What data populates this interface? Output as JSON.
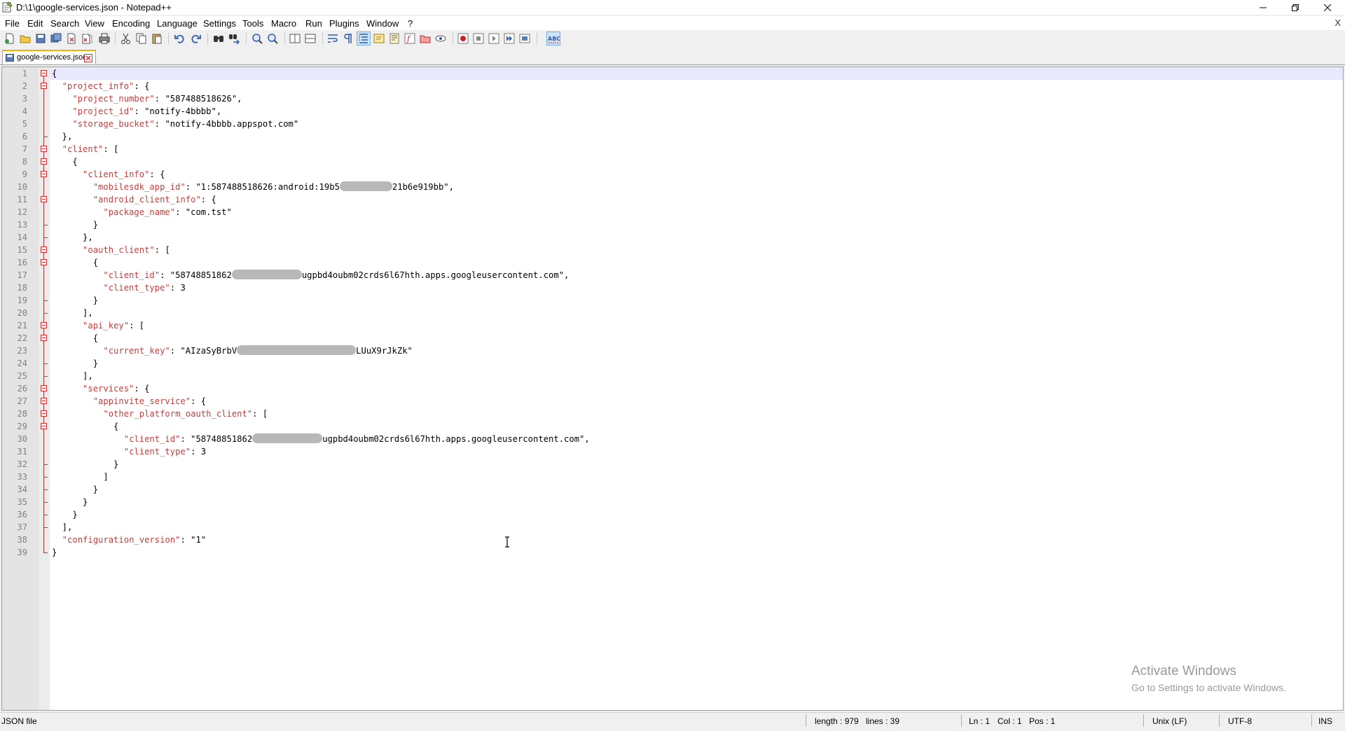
{
  "window": {
    "title": "D:\\1\\google-services.json - Notepad++"
  },
  "menu": [
    "File",
    "Edit",
    "Search",
    "View",
    "Encoding",
    "Language",
    "Settings",
    "Tools",
    "Macro",
    "Run",
    "Plugins",
    "Window",
    "?"
  ],
  "menu_close": "X",
  "tab": {
    "label": "google-services.json"
  },
  "lines": [
    {
      "n": "1",
      "segs": [
        [
          "p",
          "{"
        ]
      ]
    },
    {
      "n": "2",
      "segs": [
        [
          "p",
          "  "
        ],
        [
          "k",
          "\"project_info\""
        ],
        [
          "p",
          ": {"
        ]
      ]
    },
    {
      "n": "3",
      "segs": [
        [
          "p",
          "    "
        ],
        [
          "k",
          "\"project_number\""
        ],
        [
          "p",
          ": \"587488518626\","
        ]
      ]
    },
    {
      "n": "4",
      "segs": [
        [
          "p",
          "    "
        ],
        [
          "k",
          "\"project_id\""
        ],
        [
          "p",
          ": \"notify-4bbbb\","
        ]
      ]
    },
    {
      "n": "5",
      "segs": [
        [
          "p",
          "    "
        ],
        [
          "k",
          "\"storage_bucket\""
        ],
        [
          "p",
          ": \"notify-4bbbb.appspot.com\""
        ]
      ]
    },
    {
      "n": "6",
      "segs": [
        [
          "p",
          "  },"
        ]
      ]
    },
    {
      "n": "7",
      "segs": [
        [
          "p",
          "  "
        ],
        [
          "k",
          "\"client\""
        ],
        [
          "p",
          ": ["
        ]
      ]
    },
    {
      "n": "8",
      "segs": [
        [
          "p",
          "    {"
        ]
      ]
    },
    {
      "n": "9",
      "segs": [
        [
          "p",
          "      "
        ],
        [
          "k",
          "\"client_info\""
        ],
        [
          "p",
          ": {"
        ]
      ]
    },
    {
      "n": "10",
      "segs": [
        [
          "p",
          "        "
        ],
        [
          "k",
          "\"mobilesdk_app_id\""
        ],
        [
          "p",
          ": \"1:587488518626:android:19b5"
        ],
        [
          "b",
          "75"
        ],
        [
          "p",
          "21b6e919bb\","
        ]
      ]
    },
    {
      "n": "11",
      "segs": [
        [
          "p",
          "        "
        ],
        [
          "k",
          "\"android_client_info\""
        ],
        [
          "p",
          ": {"
        ]
      ]
    },
    {
      "n": "12",
      "segs": [
        [
          "p",
          "          "
        ],
        [
          "k",
          "\"package_name\""
        ],
        [
          "p",
          ": \"com.tst\""
        ]
      ]
    },
    {
      "n": "13",
      "segs": [
        [
          "p",
          "        }"
        ]
      ]
    },
    {
      "n": "14",
      "segs": [
        [
          "p",
          "      },"
        ]
      ]
    },
    {
      "n": "15",
      "segs": [
        [
          "p",
          "      "
        ],
        [
          "k",
          "\"oauth_client\""
        ],
        [
          "p",
          ": ["
        ]
      ]
    },
    {
      "n": "16",
      "segs": [
        [
          "p",
          "        {"
        ]
      ]
    },
    {
      "n": "17",
      "segs": [
        [
          "p",
          "          "
        ],
        [
          "k",
          "\"client_id\""
        ],
        [
          "p",
          ": \"58748851862"
        ],
        [
          "b",
          "100"
        ],
        [
          "p",
          "ugpbd4oubm02crds6l67hth.apps.googleusercontent.com\","
        ]
      ]
    },
    {
      "n": "18",
      "segs": [
        [
          "p",
          "          "
        ],
        [
          "k",
          "\"client_type\""
        ],
        [
          "p",
          ": 3"
        ]
      ]
    },
    {
      "n": "19",
      "segs": [
        [
          "p",
          "        }"
        ]
      ]
    },
    {
      "n": "20",
      "segs": [
        [
          "p",
          "      ],"
        ]
      ]
    },
    {
      "n": "21",
      "segs": [
        [
          "p",
          "      "
        ],
        [
          "k",
          "\"api_key\""
        ],
        [
          "p",
          ": ["
        ]
      ]
    },
    {
      "n": "22",
      "segs": [
        [
          "p",
          "        {"
        ]
      ]
    },
    {
      "n": "23",
      "segs": [
        [
          "p",
          "          "
        ],
        [
          "k",
          "\"current_key\""
        ],
        [
          "p",
          ": \"AIzaSyBrbV"
        ],
        [
          "b",
          "170"
        ],
        [
          "p",
          "LUuX9rJkZk\""
        ]
      ]
    },
    {
      "n": "24",
      "segs": [
        [
          "p",
          "        }"
        ]
      ]
    },
    {
      "n": "25",
      "segs": [
        [
          "p",
          "      ],"
        ]
      ]
    },
    {
      "n": "26",
      "segs": [
        [
          "p",
          "      "
        ],
        [
          "k",
          "\"services\""
        ],
        [
          "p",
          ": {"
        ]
      ]
    },
    {
      "n": "27",
      "segs": [
        [
          "p",
          "        "
        ],
        [
          "k",
          "\"appinvite_service\""
        ],
        [
          "p",
          ": {"
        ]
      ]
    },
    {
      "n": "28",
      "segs": [
        [
          "p",
          "          "
        ],
        [
          "k",
          "\"other_platform_oauth_client\""
        ],
        [
          "p",
          ": ["
        ]
      ]
    },
    {
      "n": "29",
      "segs": [
        [
          "p",
          "            {"
        ]
      ]
    },
    {
      "n": "30",
      "segs": [
        [
          "p",
          "              "
        ],
        [
          "k",
          "\"client_id\""
        ],
        [
          "p",
          ": \"58748851862"
        ],
        [
          "b",
          "100"
        ],
        [
          "p",
          "ugpbd4oubm02crds6l67hth.apps.googleusercontent.com\","
        ]
      ]
    },
    {
      "n": "31",
      "segs": [
        [
          "p",
          "              "
        ],
        [
          "k",
          "\"client_type\""
        ],
        [
          "p",
          ": 3"
        ]
      ]
    },
    {
      "n": "32",
      "segs": [
        [
          "p",
          "            }"
        ]
      ]
    },
    {
      "n": "33",
      "segs": [
        [
          "p",
          "          ]"
        ]
      ]
    },
    {
      "n": "34",
      "segs": [
        [
          "p",
          "        }"
        ]
      ]
    },
    {
      "n": "35",
      "segs": [
        [
          "p",
          "      }"
        ]
      ]
    },
    {
      "n": "36",
      "segs": [
        [
          "p",
          "    }"
        ]
      ]
    },
    {
      "n": "37",
      "segs": [
        [
          "p",
          "  ],"
        ]
      ]
    },
    {
      "n": "38",
      "segs": [
        [
          "p",
          "  "
        ],
        [
          "k",
          "\"configuration_version\""
        ],
        [
          "p",
          ": \"1\""
        ]
      ]
    },
    {
      "n": "39",
      "segs": [
        [
          "p",
          "}"
        ]
      ]
    }
  ],
  "watermark": {
    "line1": "Activate Windows",
    "line2": "Go to Settings to activate Windows."
  },
  "status": {
    "file_type": "JSON file",
    "length": "length : 979",
    "lines": "lines : 39",
    "ln": "Ln : 1",
    "col": "Col : 1",
    "pos": "Pos : 1",
    "eol": "Unix (LF)",
    "encoding": "UTF-8",
    "mode": "INS"
  },
  "colors": {
    "key": "#c14040",
    "fold": "#d03030",
    "tab_accent": "#f6b000",
    "current_line": "#e8e8ff"
  }
}
